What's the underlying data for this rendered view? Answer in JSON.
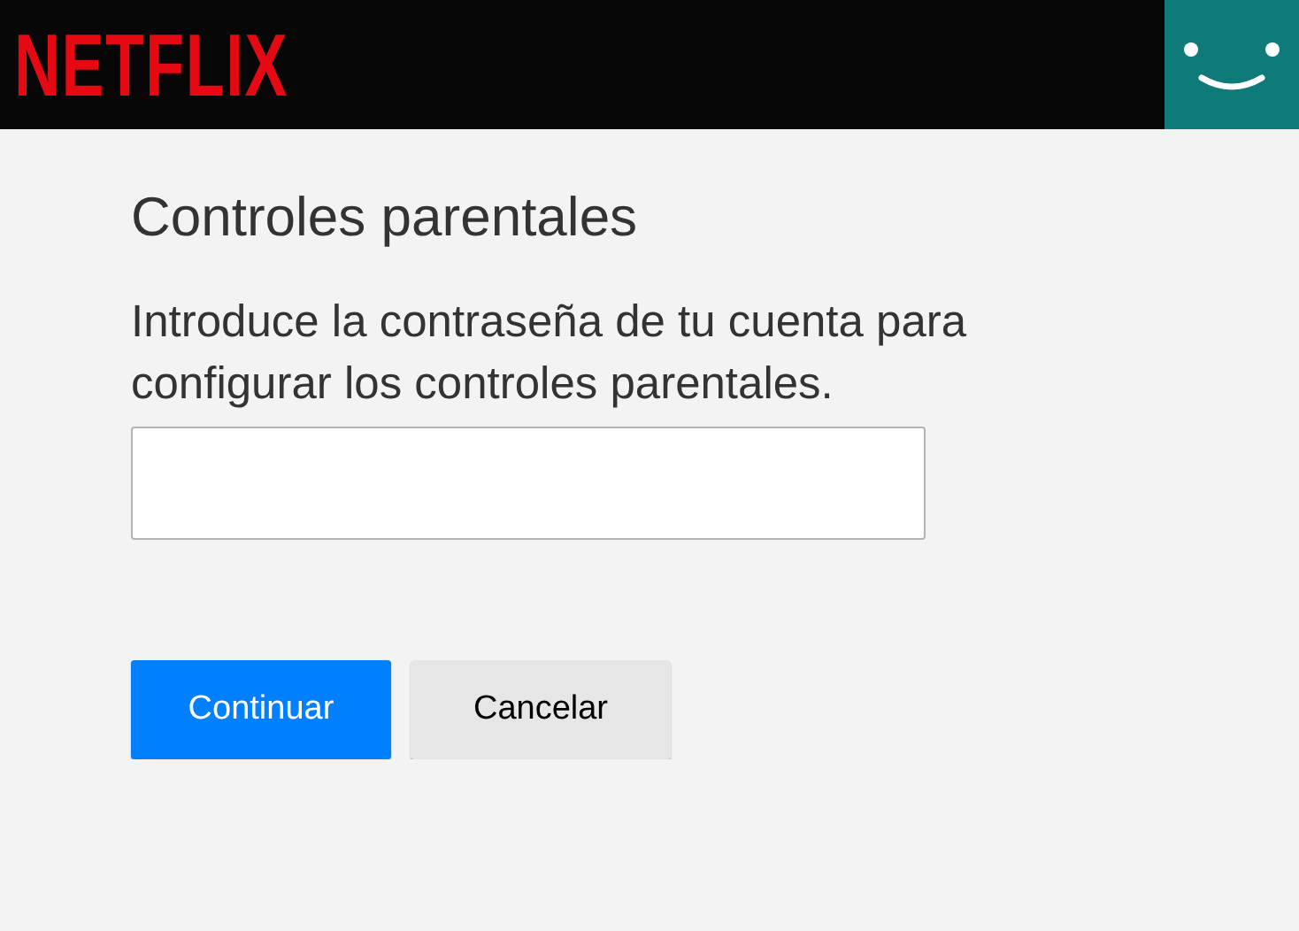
{
  "header": {
    "logo": "NETFLIX"
  },
  "title": "Controles parentales",
  "instructions": "Introduce la contraseña de tu cuenta para configurar los controles parentales.",
  "buttons": [
    {
      "label": "Continuar",
      "kind": "primary"
    },
    {
      "label": "Cancelar",
      "kind": "secondary"
    }
  ]
}
